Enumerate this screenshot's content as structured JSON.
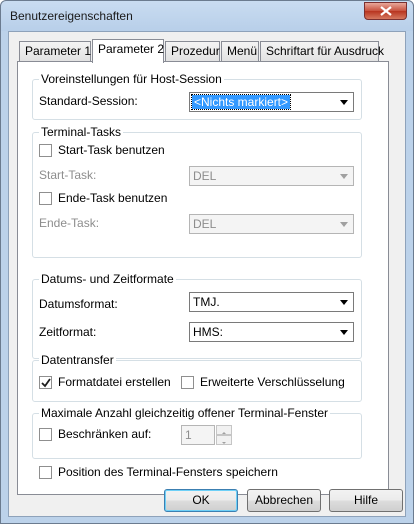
{
  "window": {
    "title": "Benutzereigenschaften"
  },
  "tabs": [
    {
      "label": "Parameter 1"
    },
    {
      "label": "Parameter 2"
    },
    {
      "label": "Prozedur"
    },
    {
      "label": "Menü"
    },
    {
      "label": "Schriftart für Ausdruck"
    }
  ],
  "host_session": {
    "title": "Voreinstellungen für Host-Session",
    "standard_session_label": "Standard-Session:",
    "standard_session_value": "<Nichts markiert>"
  },
  "terminal_tasks": {
    "title": "Terminal-Tasks",
    "start_task_checkbox_label": "Start-Task benutzen",
    "start_task_checked": false,
    "start_task_label": "Start-Task:",
    "start_task_value": "DEL",
    "end_task_checkbox_label": "Ende-Task benutzen",
    "end_task_checked": false,
    "end_task_label": "Ende-Task:",
    "end_task_value": "DEL"
  },
  "date_time": {
    "title": "Datums- und Zeitformate",
    "date_label": "Datumsformat:",
    "date_value": "TMJ.",
    "time_label": "Zeitformat:",
    "time_value": "HMS:"
  },
  "data_transfer": {
    "title": "Datentransfer",
    "format_file_label": "Formatdatei erstellen",
    "format_file_checked": true,
    "encryption_label": "Erweiterte Verschlüsselung",
    "encryption_checked": false
  },
  "max_windows": {
    "title": "Maximale Anzahl gleichzeitig offener Terminal-Fenster",
    "limit_label": "Beschränken auf:",
    "limit_checked": false,
    "limit_value": "1"
  },
  "save_position": {
    "label": "Position des Terminal-Fensters speichern",
    "checked": false
  },
  "buttons": {
    "ok": "OK",
    "cancel": "Abbrechen",
    "help": "Hilfe"
  }
}
